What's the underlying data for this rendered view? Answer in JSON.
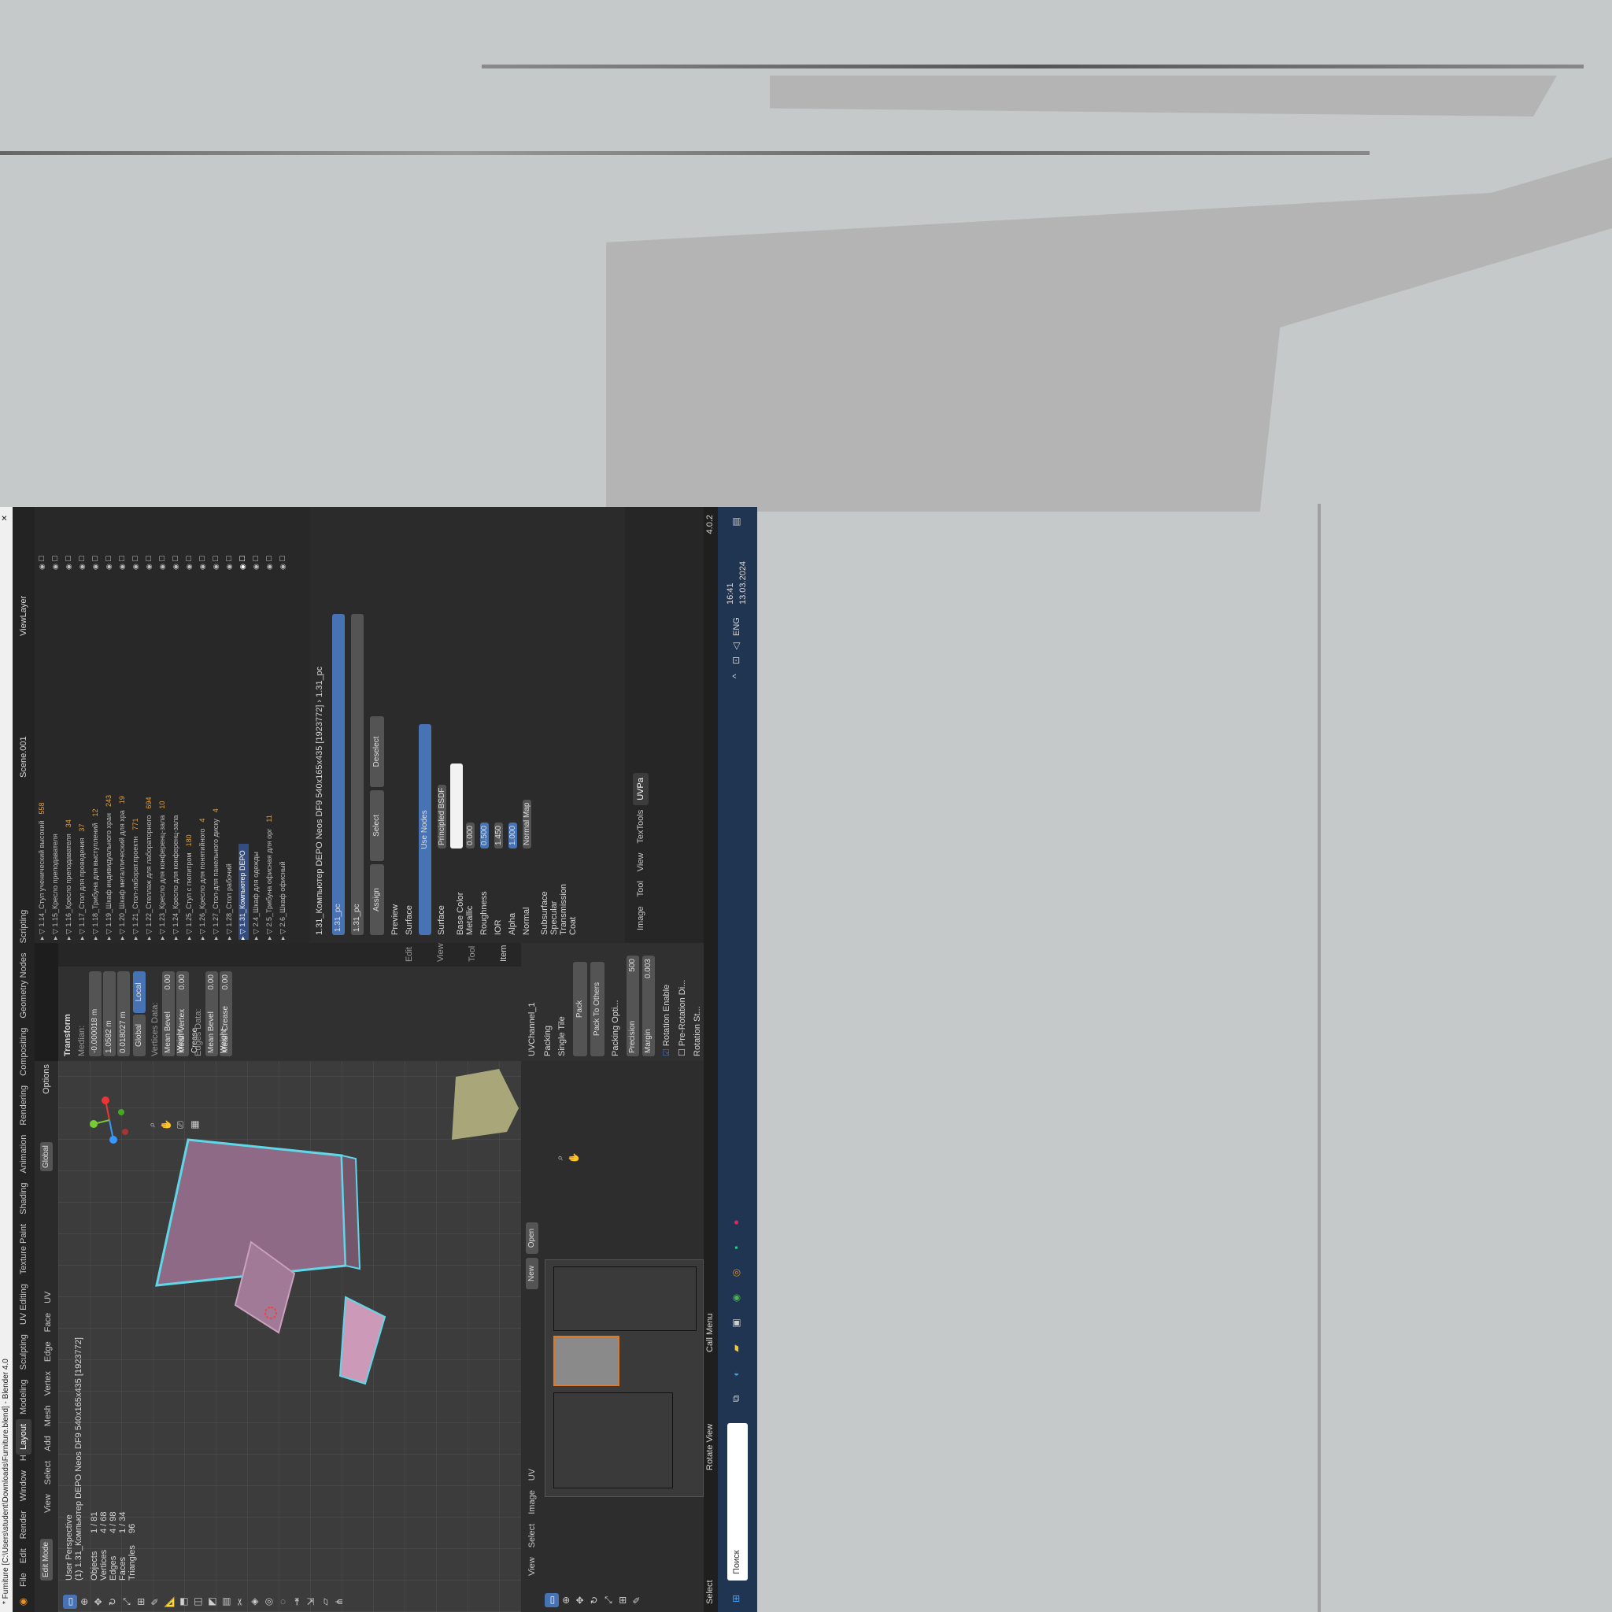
{
  "window": {
    "title": "* Furniture [C:\\Users\\student\\Downloads\\Furniture.blend] - Blender 4.0",
    "version": "4.0.2"
  },
  "menu": {
    "items": [
      "File",
      "Edit",
      "Render",
      "Window",
      "Help"
    ],
    "workspaces": [
      "Layout",
      "Modeling",
      "Sculpting",
      "UV Editing",
      "Texture Paint",
      "Shading",
      "Animation",
      "Rendering",
      "Compositing",
      "Geometry Nodes",
      "Scripting"
    ],
    "active_workspace": "Layout",
    "scene": "Scene.001",
    "view_layer": "ViewLayer"
  },
  "viewport_header": {
    "mode": "Edit Mode",
    "menus": [
      "View",
      "Select",
      "Add",
      "Mesh",
      "Vertex",
      "Edge",
      "Face",
      "UV"
    ],
    "orientation": "Global",
    "options": "Options"
  },
  "viewport": {
    "perspective": "User Perspective",
    "object": "(1) 1.31_Компьютер DEPO Neos DF9 540x165x435 [1923772]",
    "stats": [
      {
        "label": "Objects",
        "value": "1 / 81"
      },
      {
        "label": "Vertices",
        "value": "4 / 68"
      },
      {
        "label": "Edges",
        "value": "4 / 98"
      },
      {
        "label": "Faces",
        "value": "1 / 34"
      },
      {
        "label": "Triangles",
        "value": "96"
      }
    ]
  },
  "n_panel": {
    "tabs": [
      "Item",
      "Tool",
      "View",
      "Edit"
    ],
    "transform_label": "Transform",
    "median_label": "Median:",
    "x": "-0.000018 m",
    "y": "1.0582 m",
    "z": "0.018027 m",
    "global": "Global",
    "local": "Local",
    "vertices_data": "Vertices Data:",
    "mean_bevel_weight_label": "Mean Bevel Weight",
    "mean_bevel_weight": "0.00",
    "mean_vertex_crease_label": "Mean Vertex Crease",
    "mean_vertex_crease": "0.00",
    "edges_data": "Edges Data:",
    "edge_bevel_label": "Mean Bevel Weight",
    "edge_bevel": "0.00",
    "mean_crease_label": "Mean Crease",
    "mean_crease": "0.00"
  },
  "outliner": {
    "items": [
      {
        "name": "1.14_Стул ученический высокий",
        "count": "558"
      },
      {
        "name": "1.15_Кресло преподавателя",
        "count": ""
      },
      {
        "name": "1.16_Кресло преподавателя",
        "count": "34"
      },
      {
        "name": "1.17_Стол для проведения",
        "count": "37"
      },
      {
        "name": "1.18_Трибуна для выступлений",
        "count": "12"
      },
      {
        "name": "1.19_Шкаф индивидуального хран",
        "count": "243"
      },
      {
        "name": "1.20_Шкаф металлический для хра",
        "count": "19"
      },
      {
        "name": "1.21_Стол-лаборат.проектн",
        "count": "771"
      },
      {
        "name": "1.22_Стеллаж для лабораторного",
        "count": "694"
      },
      {
        "name": "1.23_Кресло для конференц-зала",
        "count": "10"
      },
      {
        "name": "1.24_Кресло для конференц-зала",
        "count": ""
      },
      {
        "name": "1.25_Стул с пюпитром",
        "count": "180"
      },
      {
        "name": "1.26_Кресло для понятийного",
        "count": "4"
      },
      {
        "name": "1.27_Стол-для панельного диску",
        "count": "4"
      },
      {
        "name": "1.28_Стол рабочий",
        "count": ""
      },
      {
        "name": "1.31_Компьютер DEPO",
        "count": ""
      },
      {
        "name": "2.4_Шкаф для одежды",
        "count": ""
      },
      {
        "name": "2.5_Трибуна офисная для орг",
        "count": "11"
      },
      {
        "name": "2.6_Шкаф офисный",
        "count": ""
      }
    ]
  },
  "properties": {
    "breadcrumb_object": "1.31_Компьютер DEPO Neos DF9 540x165x435 [1923772]",
    "breadcrumb_material": "1.31_pc",
    "material_slot": "1.31_pc",
    "material_name": "1.31_pc",
    "buttons": {
      "assign": "Assign",
      "select": "Select",
      "deselect": "Deselect"
    },
    "preview": "Preview",
    "surface_section": "Surface",
    "use_nodes": "Use Nodes",
    "surface_label": "Surface",
    "surface_value": "Principled BSDF",
    "inputs": [
      {
        "label": "Base Color",
        "value": ""
      },
      {
        "label": "Metallic",
        "value": "0.000"
      },
      {
        "label": "Roughness",
        "value": "0.500"
      },
      {
        "label": "IOR",
        "value": "1.450"
      },
      {
        "label": "Alpha",
        "value": "1.000"
      },
      {
        "label": "Normal",
        "value": "Normal Map"
      }
    ],
    "subsections": [
      "Subsurface",
      "Specular",
      "Transmission",
      "Coat"
    ]
  },
  "uv_editor": {
    "menus": [
      "View",
      "Select",
      "Image",
      "UV"
    ],
    "image_buttons": {
      "new": "New",
      "open": "Open"
    },
    "tabs": [
      "Image",
      "Tool",
      "View",
      "TexTools",
      "UVPa"
    ],
    "uv_channel": "UVChannel_1",
    "packing": "Packing",
    "single_tile": "Single Tile",
    "pack": "Pack",
    "pack_to_others": "Pack To Others",
    "packing_options": "Packing Opti...",
    "precision_label": "Precision",
    "precision": "500",
    "margin_label": "Margin",
    "margin": "0.003",
    "rotation_enable": "Rotation Enable",
    "pre_rotation": "Pre-Rotation Di...",
    "rotation_step": "Rotation St..."
  },
  "status": {
    "select": "Select",
    "rotate_view": "Rotate View",
    "call_menu": "Call Menu"
  },
  "taskbar": {
    "search": "Поиск",
    "language": "ENG",
    "time": "16:41",
    "date": "13.03.2024"
  },
  "colors": {
    "accent": "#4772b3",
    "mesh_fill": "#8e6a86",
    "mesh_edge": "#5fd7e6",
    "taskbar": "#1f3552"
  }
}
